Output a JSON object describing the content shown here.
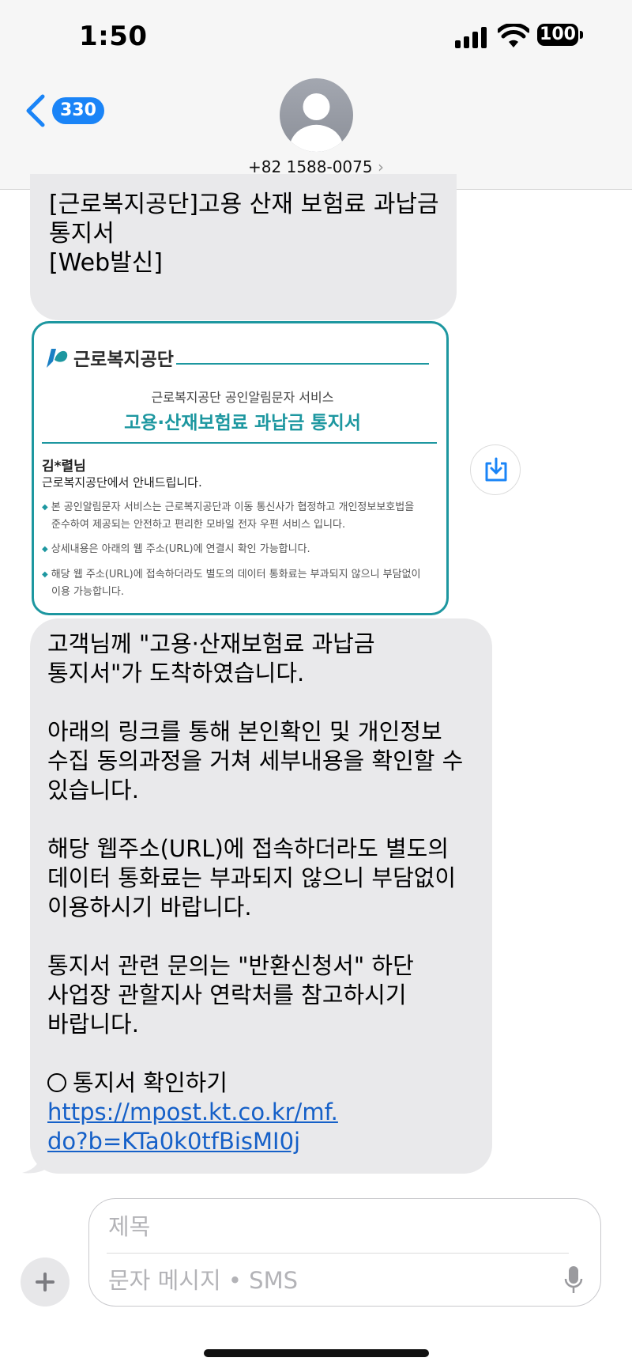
{
  "status_bar": {
    "time": "1:50",
    "battery": "100"
  },
  "header": {
    "back_badge": "330",
    "contact": "+82 1588-0075",
    "chevron": "›"
  },
  "messages": {
    "first": {
      "lines": [
        "[근로복지공단]고용 산재 보험료 과납금",
        "통지서",
        "[Web발신]"
      ]
    },
    "card": {
      "logo_text": "근로복지공단",
      "service": "근로복지공단 공인알림문자 서비스",
      "title": "고용·산재보험료 과납금 통지서",
      "name": "김*렬님",
      "greeting": "근로복지공단에서 안내드립니다.",
      "bullet1_line1": "본 공인알림문자 서비스는 근로복지공단과 이동 통신사가 협정하고 개인정보보호법을",
      "bullet1_line2": "준수하여 제공되는 안전하고 편리한 모바일 전자 우편 서비스 입니다.",
      "bullet2": "상세내용은 아래의 웹 주소(URL)에 연결시 확인 가능합니다.",
      "bullet3_line1": "해당 웹 주소(URL)에 접속하더라도 별도의 데이터 통화료는 부과되지 않으니 부담없이",
      "bullet3_line2": "이용 가능합니다."
    },
    "body": {
      "lines": [
        "고객님께 \"고용·산재보험료 과납금",
        "통지서\"가 도착하였습니다.",
        "",
        "아래의 링크를 통해 본인확인 및 개인정보",
        "수집 동의과정을 거쳐 세부내용을 확인할 수",
        "있습니다.",
        "",
        "해당 웹주소(URL)에 접속하더라도 별도의",
        "데이터 통화료는 부과되지 않으니 부담없이",
        "이용하시기 바랍니다.",
        "",
        "통지서 관련 문의는 \"반환신청서\" 하단",
        "사업장 관할지사 연락처를 참고하시기",
        "바랍니다.",
        ""
      ],
      "confirm_label": "통지서 확인하기",
      "link_line1": "https://mpost.kt.co.kr/mf.",
      "link_line2": "do?b=KTa0k0tfBisMI0j"
    }
  },
  "composer": {
    "subject_placeholder": "제목",
    "message_placeholder": "문자 메시지 • SMS"
  },
  "colors": {
    "accent": "#1a84f7",
    "bubble": "#e9e9eb",
    "card_teal": "#1d97a0",
    "link": "#1560c8"
  },
  "icons": [
    "back-chevron-icon",
    "person-icon",
    "save-icon",
    "plus-icon",
    "mic-icon",
    "signal-icon",
    "wifi-icon",
    "battery-icon"
  ]
}
